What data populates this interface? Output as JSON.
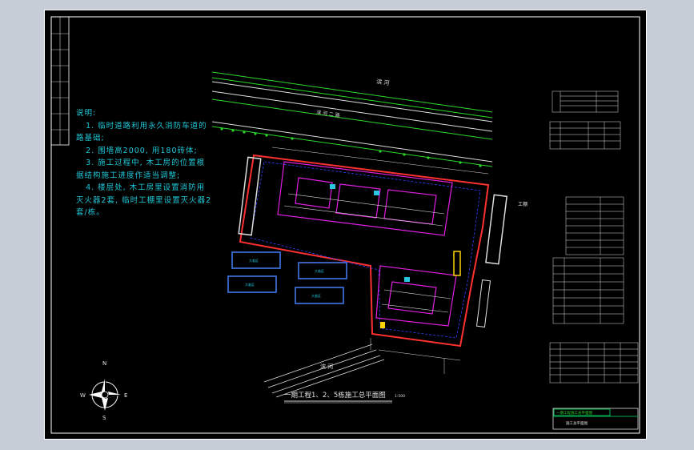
{
  "notes": {
    "heading": "说明:",
    "items": [
      "   1. 临时道路利用永久消防车道的路基础;",
      "   2. 围墙高2000, 用180砖体;",
      "   3. 施工过程中, 木工房的位置根据结构施工进度作适当调整;",
      "   4. 楼层处, 木工房里设置消防用灭火器2套, 临时工棚里设置灭火器2套/栋。"
    ]
  },
  "plan": {
    "title": "一期工程1、2、5栋施工总平面图",
    "scale": "1:500",
    "road_top": "滨  河",
    "road_second": "滨  河  二  路",
    "road_bottom": "滨  河",
    "right_label": "工棚",
    "compass_n": "N",
    "compass_s": "S",
    "compass_w": "W",
    "compass_e": "E"
  },
  "title_block": {
    "project": "一期工程施工总平面图",
    "drawing": "施工总平面图"
  },
  "colors": {
    "background": "#000000",
    "frame": "#ffffff",
    "notes": "#1ec8d8",
    "wall": "#ff3030",
    "building": "#e020e0",
    "road": "#2cd82c",
    "temp": "#3a5a9a",
    "dim": "#e0e0e0",
    "tablefill": "#00b050"
  }
}
